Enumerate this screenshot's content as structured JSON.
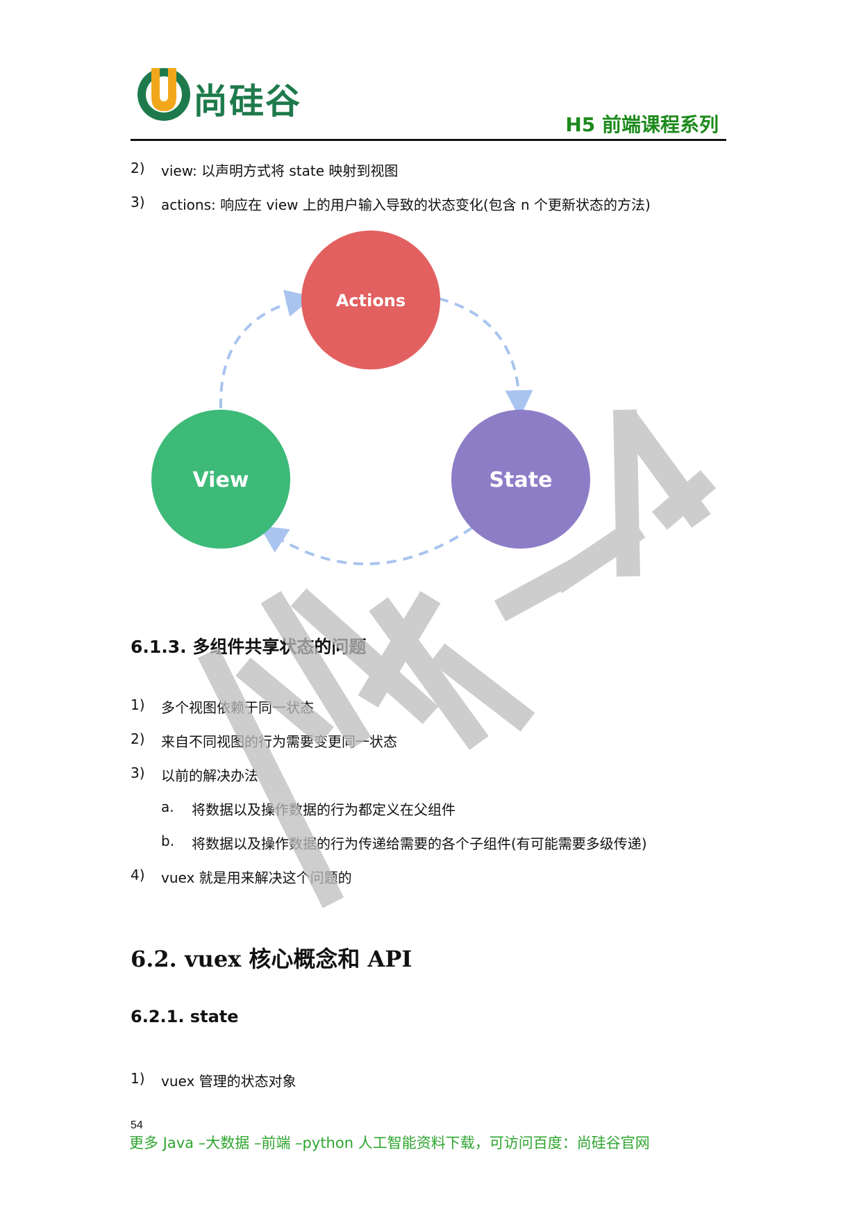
{
  "header": {
    "logo_text": "尚硅谷",
    "logo_letter": "U",
    "series": "H5 前端课程系列"
  },
  "intro_items": [
    {
      "num": "2)",
      "text": "view:  以声明方式将 state 映射到视图"
    },
    {
      "num": "3)",
      "text": "actions:  响应在 view 上的用户输入导致的状态变化(包含 n 个更新状态的方法)"
    }
  ],
  "diagram": {
    "actions_label": "Actions",
    "view_label": "View",
    "state_label": "State",
    "colors": {
      "actions": "#e2605f",
      "view": "#3dba78",
      "state": "#8d7dc7",
      "arrow": "#a8c4ef"
    }
  },
  "section_613": {
    "heading": "6.1.3.  多组件共享状态的问题",
    "items": [
      {
        "num": "1)",
        "text": "多个视图依赖于同一状态"
      },
      {
        "num": "2)",
        "text": "来自不同视图的行为需要变更同一状态"
      },
      {
        "num": "3)",
        "text": "以前的解决办法"
      }
    ],
    "subitems": [
      {
        "num": "a.",
        "text": "将数据以及操作数据的行为都定义在父组件"
      },
      {
        "num": "b.",
        "text": "将数据以及操作数据的行为传递给需要的各个子组件(有可能需要多级传递)"
      }
    ],
    "item4": {
      "num": "4)",
      "text": "vuex 就是用来解决这个问题的"
    }
  },
  "section_62": {
    "heading": "6.2. vuex 核心概念和 API"
  },
  "section_621": {
    "heading": "6.2.1. state",
    "items": [
      {
        "num": "1)",
        "text": "vuex 管理的状态对象"
      }
    ]
  },
  "page_number": "54",
  "footer": "更多 Java –大数据 –前端 –python 人工智能资料下载，可访问百度：尚硅谷官网",
  "watermark_text": "尚硅谷"
}
